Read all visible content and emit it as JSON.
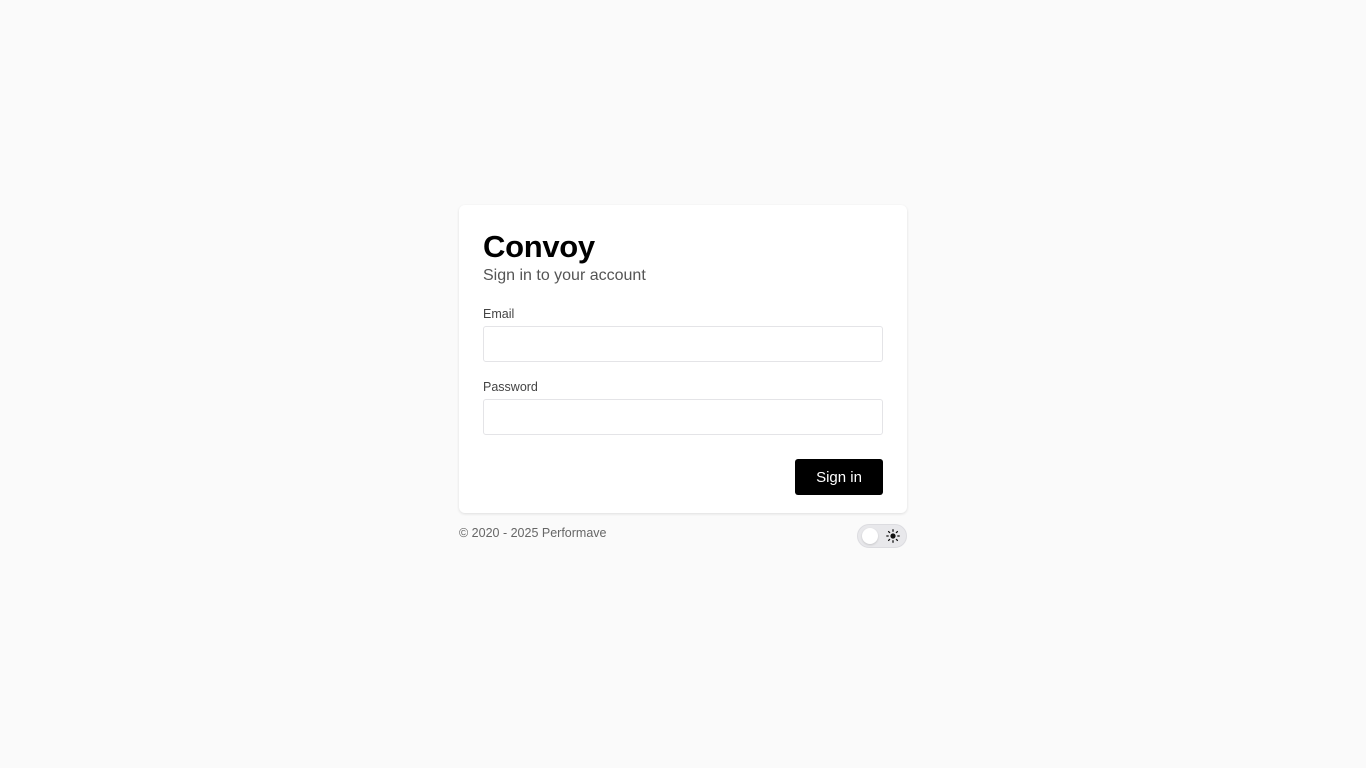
{
  "app": {
    "title": "Convoy",
    "subtitle": "Sign in to your account"
  },
  "form": {
    "email_label": "Email",
    "email_value": "",
    "email_placeholder": "",
    "password_label": "Password",
    "password_value": "",
    "password_placeholder": "",
    "submit_label": "Sign in"
  },
  "footer": {
    "copyright": "© 2020 - 2025 Performave",
    "theme_toggle_icon": "sun-icon",
    "theme": "light"
  },
  "colors": {
    "background": "#fafafa",
    "card": "#ffffff",
    "primary_button": "#000000",
    "primary_button_text": "#ffffff"
  }
}
